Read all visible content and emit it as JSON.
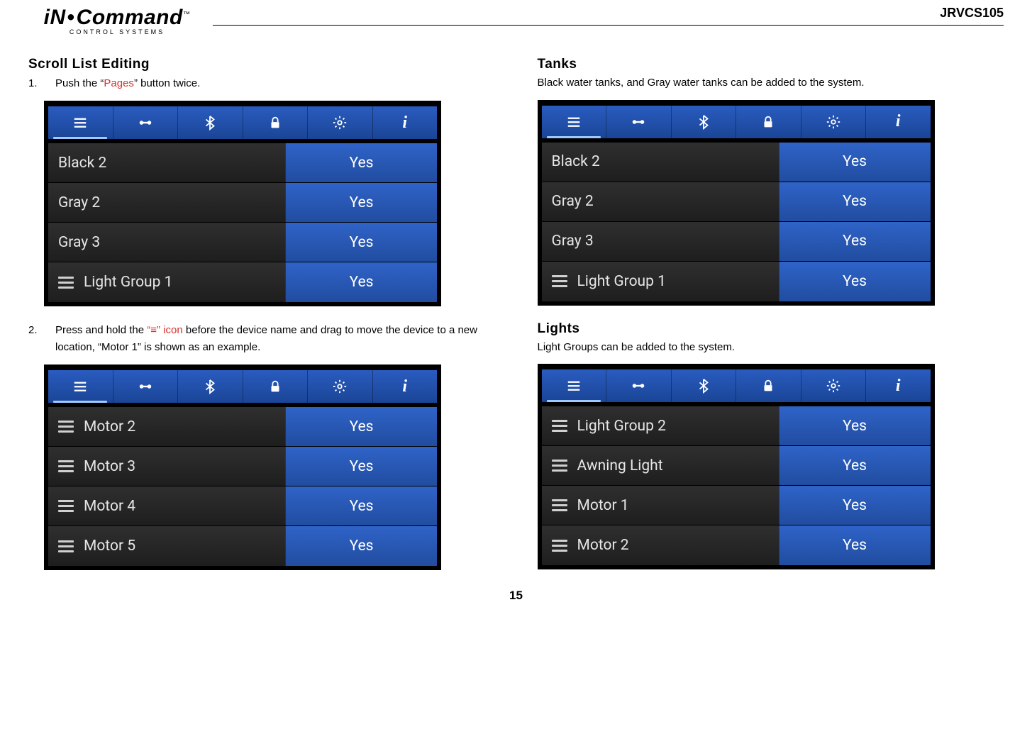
{
  "header": {
    "logo_main_a": "iN",
    "logo_main_b": "Command",
    "logo_tm": "™",
    "logo_sub": "CONTROL SYSTEMS",
    "model": "JRVCS105"
  },
  "left": {
    "title": "Scroll List Editing",
    "step1_num": "1.",
    "step1_a": "Push the ",
    "step1_q1": "“",
    "step1_red": "Pages",
    "step1_q2": "”",
    "step1_b": " button twice.",
    "step2_num": "2.",
    "step2_a": "Press and hold the ",
    "step2_q1": "“",
    "step2_red": "≡",
    "step2_q2": "”",
    "step2_icon_word": " icon",
    "step2_b": " before the device name and drag to move the device to a new location, “Motor 1” is shown as an example."
  },
  "right": {
    "tanks_title": "Tanks",
    "tanks_body": "Black water tanks, and Gray water tanks can be added to the system.",
    "lights_title": "Lights",
    "lights_body": "Light Groups can be added to the system."
  },
  "shots": {
    "a": {
      "rows": [
        {
          "drag": false,
          "label": "Black 2",
          "val": "Yes"
        },
        {
          "drag": false,
          "label": "Gray 2",
          "val": "Yes"
        },
        {
          "drag": false,
          "label": "Gray 3",
          "val": "Yes"
        },
        {
          "drag": true,
          "label": "Light Group 1",
          "val": "Yes"
        }
      ]
    },
    "b": {
      "rows": [
        {
          "drag": true,
          "label": "Motor 2",
          "val": "Yes"
        },
        {
          "drag": true,
          "label": "Motor 3",
          "val": "Yes"
        },
        {
          "drag": true,
          "label": "Motor 4",
          "val": "Yes"
        },
        {
          "drag": true,
          "label": "Motor 5",
          "val": "Yes"
        }
      ]
    },
    "c": {
      "rows": [
        {
          "drag": false,
          "label": "Black 2",
          "val": "Yes"
        },
        {
          "drag": false,
          "label": "Gray 2",
          "val": "Yes"
        },
        {
          "drag": false,
          "label": "Gray 3",
          "val": "Yes"
        },
        {
          "drag": true,
          "label": "Light Group 1",
          "val": "Yes"
        }
      ]
    },
    "d": {
      "rows": [
        {
          "drag": true,
          "label": "Light Group 2",
          "val": "Yes"
        },
        {
          "drag": true,
          "label": "Awning Light",
          "val": "Yes"
        },
        {
          "drag": true,
          "label": "Motor 1",
          "val": "Yes"
        },
        {
          "drag": true,
          "label": "Motor 2",
          "val": "Yes"
        }
      ]
    }
  },
  "page_number": "15"
}
